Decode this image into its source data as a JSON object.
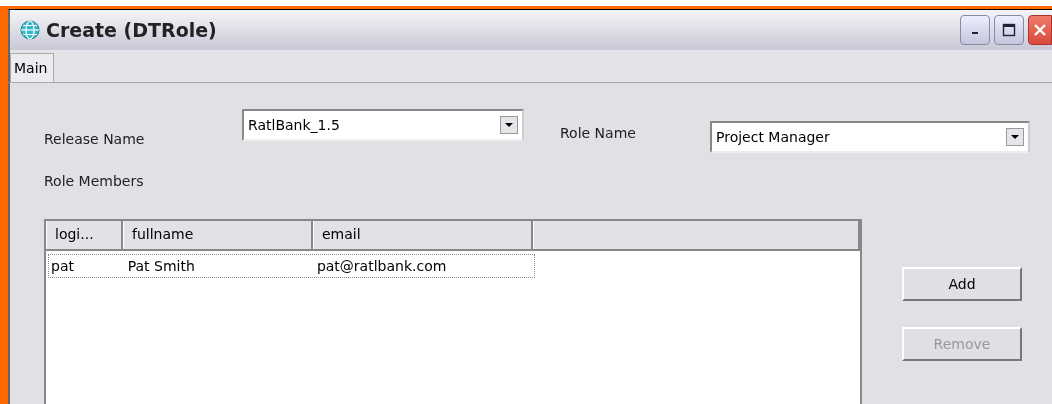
{
  "window": {
    "title": "Create (DTRole)"
  },
  "tabs": [
    {
      "label": "Main",
      "selected": true
    }
  ],
  "form": {
    "release_name": {
      "label": "Release Name",
      "value": "RatlBank_1.5"
    },
    "role_name": {
      "label": "Role Name",
      "value": "Project Manager"
    },
    "role_members_label": "Role Members"
  },
  "table": {
    "columns": [
      "logi...",
      "fullname",
      "email",
      ""
    ],
    "rows": [
      {
        "cells": [
          "pat",
          "Pat Smith",
          "pat@ratlbank.com"
        ],
        "selected": true
      }
    ]
  },
  "buttons": [
    {
      "label": "Add",
      "disabled": false
    },
    {
      "label": "Remove",
      "disabled": true
    }
  ]
}
